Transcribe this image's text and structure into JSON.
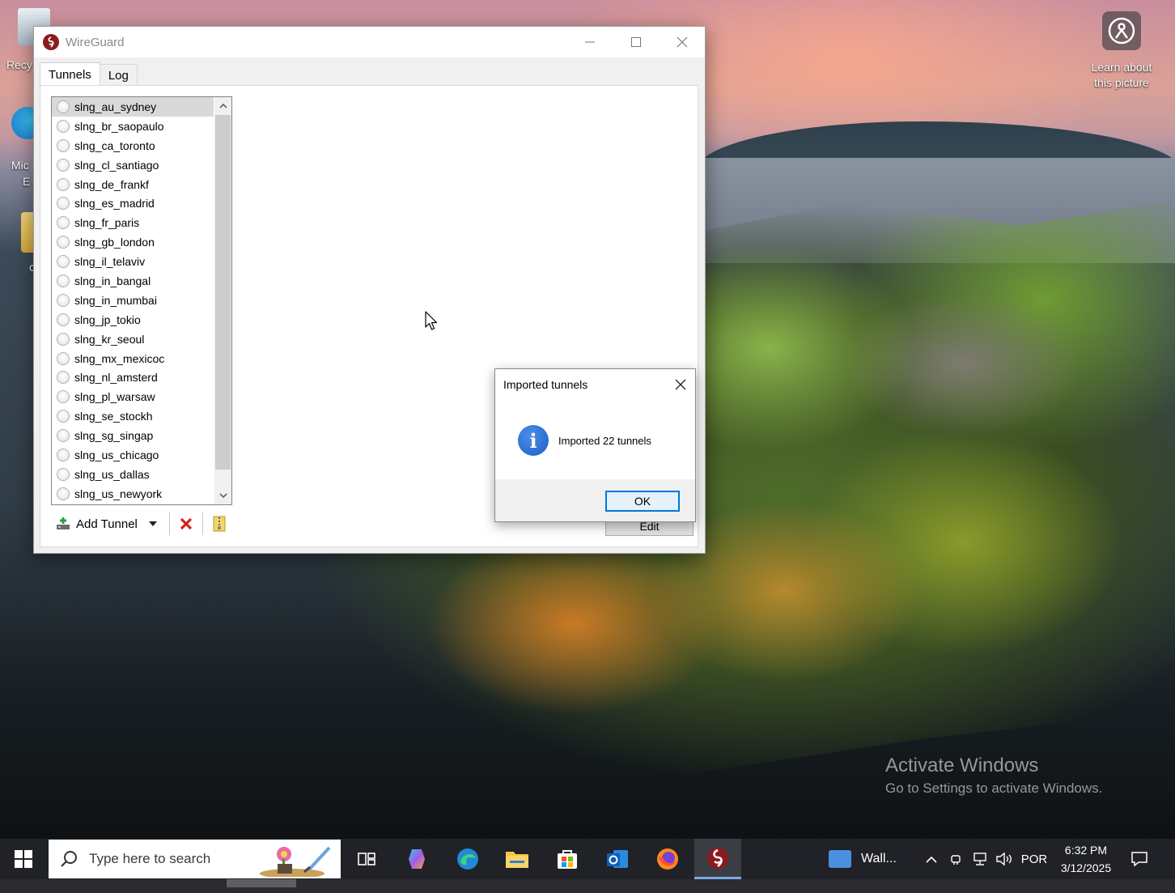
{
  "desktop": {
    "recycle_label": "Recy",
    "edge_label_1": "Mic",
    "edge_label_2": "E",
    "folder_label": "c",
    "learn_about": "Learn about this picture",
    "watermark_title": "Activate Windows",
    "watermark_sub": "Go to Settings to activate Windows."
  },
  "window": {
    "title": "WireGuard",
    "tabs": [
      {
        "label": "Tunnels",
        "active": true
      },
      {
        "label": "Log",
        "active": false
      }
    ],
    "tunnels": [
      "slng_au_sydney",
      "slng_br_saopaulo",
      "slng_ca_toronto",
      "slng_cl_santiago",
      "slng_de_frankf",
      "slng_es_madrid",
      "slng_fr_paris",
      "slng_gb_london",
      "slng_il_telaviv",
      "slng_in_bangal",
      "slng_in_mumbai",
      "slng_jp_tokio",
      "slng_kr_seoul",
      "slng_mx_mexicoc",
      "slng_nl_amsterd",
      "slng_pl_warsaw",
      "slng_se_stockh",
      "slng_sg_singap",
      "slng_us_chicago",
      "slng_us_dallas",
      "slng_us_newyork"
    ],
    "selected_index": 0,
    "toolbar": {
      "add_tunnel": "Add Tunnel"
    },
    "edit_label": "Edit"
  },
  "dialog": {
    "title": "Imported tunnels",
    "message": "Imported 22 tunnels",
    "ok_label": "OK",
    "icon": "info-icon"
  },
  "taskbar": {
    "search_placeholder": "Type here to search",
    "news_label": "Wall...",
    "language": "POR",
    "time": "6:32 PM",
    "date": "3/12/2025"
  },
  "colors": {
    "accent": "#0078d7",
    "wireguard_red": "#8b1b1f",
    "info_blue": "#1c5fc5",
    "delete_red": "#d42020"
  }
}
